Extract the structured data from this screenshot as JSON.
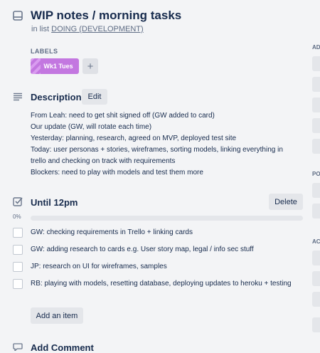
{
  "card": {
    "title": "WIP notes / morning tasks",
    "in_list_prefix": "in list",
    "list_name": "DOING (DEVELOPMENT)"
  },
  "labels": {
    "header": "LABELS",
    "items": [
      {
        "name": "Wk1 Tues",
        "color": "#c377e0"
      }
    ],
    "add_label": "+"
  },
  "description": {
    "title": "Description",
    "edit_label": "Edit",
    "lines": [
      "From Leah: need to get shit signed off (GW added to card)",
      "Our update (GW, will rotate each time)",
      "Yesterday: planning, research, agreed on MVP, deployed test site",
      "Today: user personas + stories, wireframes, sorting models, linking everything in",
      "trello and checking on track with requirements",
      "Blockers: need to play with models and test them more"
    ]
  },
  "checklist": {
    "title": "Until 12pm",
    "delete_label": "Delete",
    "progress_text": "0%",
    "progress_fraction": 0,
    "items": [
      {
        "text": "GW: checking requirements in Trello + linking cards",
        "checked": false
      },
      {
        "text": "GW: adding research to cards e.g. User story map, legal / info sec stuff",
        "checked": false
      },
      {
        "text": "JP: research on UI for wireframes, samples",
        "checked": false
      },
      {
        "text": "RB: playing with models, resetting database, deploying updates to heroku + testing",
        "checked": false
      }
    ],
    "add_item_label": "Add an item"
  },
  "comment": {
    "title": "Add Comment"
  },
  "sidebar": {
    "headers": [
      "AD",
      "PO",
      "AC"
    ]
  },
  "colors": {
    "accent_green": "#61bd4f",
    "label_purple": "#c377e0"
  }
}
